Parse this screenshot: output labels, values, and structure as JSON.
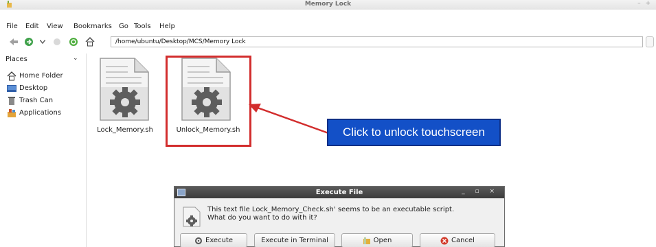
{
  "window": {
    "title": "Memory Lock"
  },
  "menu": [
    "File",
    "Edit",
    "View",
    "Bookmarks",
    "Go",
    "Tools",
    "Help"
  ],
  "toolbar": {
    "location_path": "/home/ubuntu/Desktop/MCS/Memory Lock",
    "icons": [
      "back-icon",
      "forward-icon",
      "dropdown-icon",
      "stop-icon",
      "reload-icon",
      "home-icon"
    ]
  },
  "sidebar": {
    "header": "Places",
    "items": [
      {
        "label": "Home Folder",
        "icon": "home-icon"
      },
      {
        "label": "Desktop",
        "icon": "desktop-icon"
      },
      {
        "label": "Trash Can",
        "icon": "trash-icon"
      },
      {
        "label": "Applications",
        "icon": "applications-icon"
      }
    ]
  },
  "files": [
    {
      "name": "Lock_Memory.sh",
      "icon": "script-file-icon"
    },
    {
      "name": "Unlock_Memory.sh",
      "icon": "script-file-icon"
    }
  ],
  "annotation": {
    "callout_text": "Click to unlock touchscreen",
    "colors": {
      "box": "#d22d2d",
      "callout_bg": "#1350c7",
      "callout_text": "#ffffff"
    }
  },
  "dialog": {
    "title": "Execute File",
    "message_line1": "This text file Lock_Memory_Check.sh' seems to be an executable script.",
    "message_line2": "What do you want to do with it?",
    "buttons": {
      "execute": "Execute",
      "execute_terminal": "Execute in Terminal",
      "open": "Open",
      "cancel": "Cancel"
    }
  }
}
